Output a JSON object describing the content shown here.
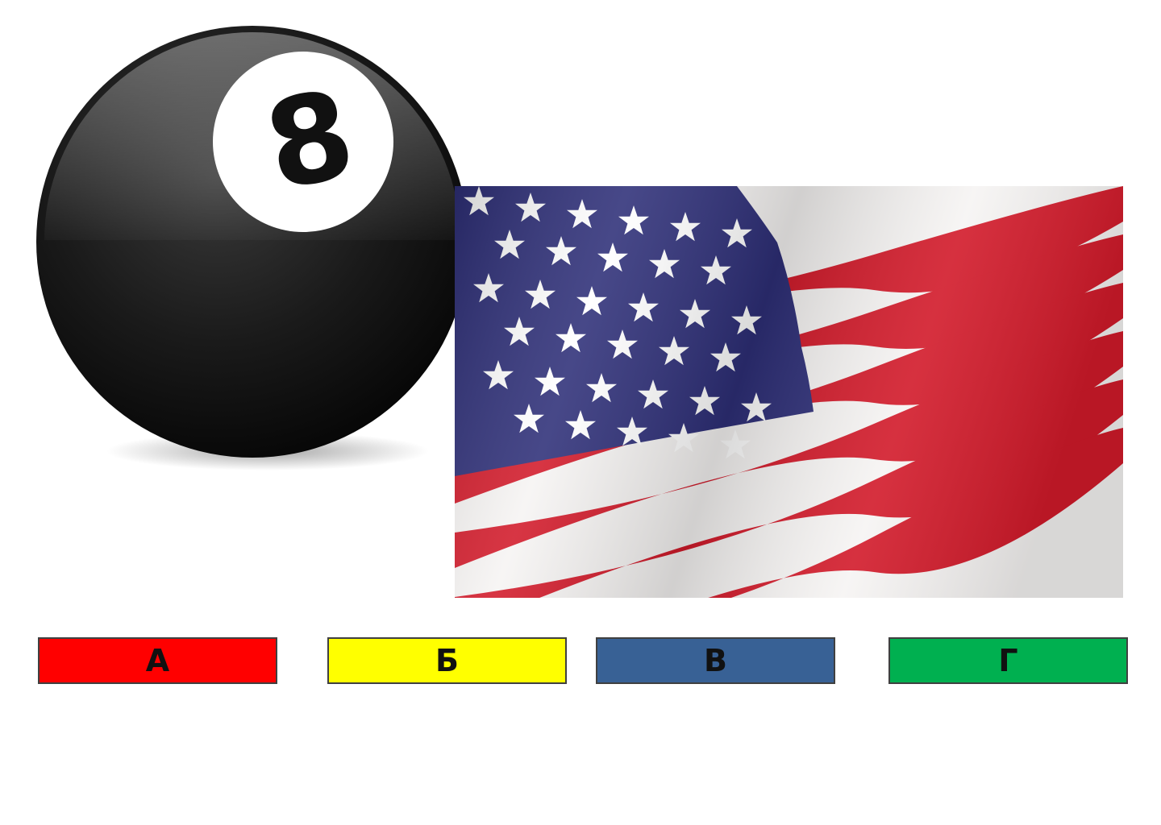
{
  "ball": {
    "number": "8",
    "icon": "eight-ball-icon"
  },
  "flag": {
    "icon": "us-flag-icon",
    "colors": {
      "red": "#d21a2a",
      "white": "#f6f4f3",
      "blue": "#2e2f78"
    }
  },
  "answers": [
    {
      "label": "А",
      "color": "#ff0000"
    },
    {
      "label": "Б",
      "color": "#ffff00"
    },
    {
      "label": "В",
      "color": "#386195"
    },
    {
      "label": "Г",
      "color": "#00b050"
    }
  ]
}
